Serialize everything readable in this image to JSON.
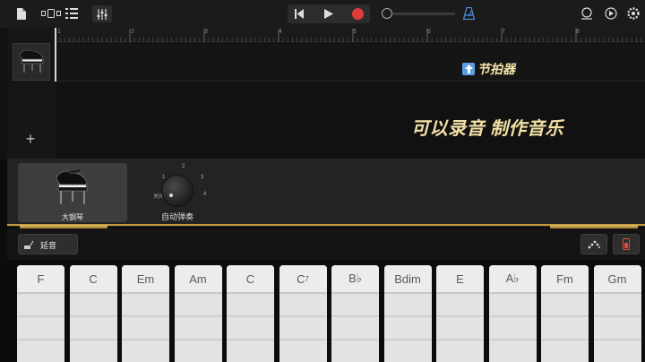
{
  "toolbar": {
    "left_icons": [
      "document-icon",
      "view-toggle-icon",
      "tracks-list-icon",
      "mixer-icon"
    ],
    "transport": [
      "rewind-icon",
      "play-icon",
      "record-icon"
    ],
    "metronome_icon": "metronome-icon",
    "right_icons": [
      "loop-icon",
      "tempo-icon",
      "settings-icon"
    ],
    "volume_level": 0
  },
  "ruler": {
    "bars": [
      "1",
      "2",
      "3",
      "4",
      "5",
      "6",
      "7",
      "8"
    ]
  },
  "metronome_badge": "节拍器",
  "caption": "可以录音 制作音乐",
  "track": {
    "instrument_icon": "grand-piano-icon",
    "add_label": "+"
  },
  "instrument": {
    "name": "大钢琴"
  },
  "autoplay": {
    "label": "自动弹奏",
    "ticks": [
      "关闭",
      "1",
      "2",
      "3",
      "4"
    ]
  },
  "controls": {
    "sustain_label": "延音",
    "arpeggiator_icon": "arpeggiator-icon",
    "device_icon": "phone-icon"
  },
  "chords": [
    {
      "root": "F",
      "sup": ""
    },
    {
      "root": "C",
      "sup": ""
    },
    {
      "root": "Em",
      "sup": ""
    },
    {
      "root": "Am",
      "sup": ""
    },
    {
      "root": "C",
      "sup": ""
    },
    {
      "root": "C",
      "sup": "7"
    },
    {
      "root": "B♭",
      "sup": ""
    },
    {
      "root": "Bdim",
      "sup": ""
    },
    {
      "root": "E",
      "sup": ""
    },
    {
      "root": "A♭",
      "sup": ""
    },
    {
      "root": "Fm",
      "sup": ""
    },
    {
      "root": "Gm",
      "sup": ""
    }
  ],
  "colors": {
    "record": "#e23b3b",
    "metronome": "#4d8fe0",
    "caption": "#f3e2a6",
    "gold": "#c49a3c",
    "phone": "#e24a3a"
  }
}
